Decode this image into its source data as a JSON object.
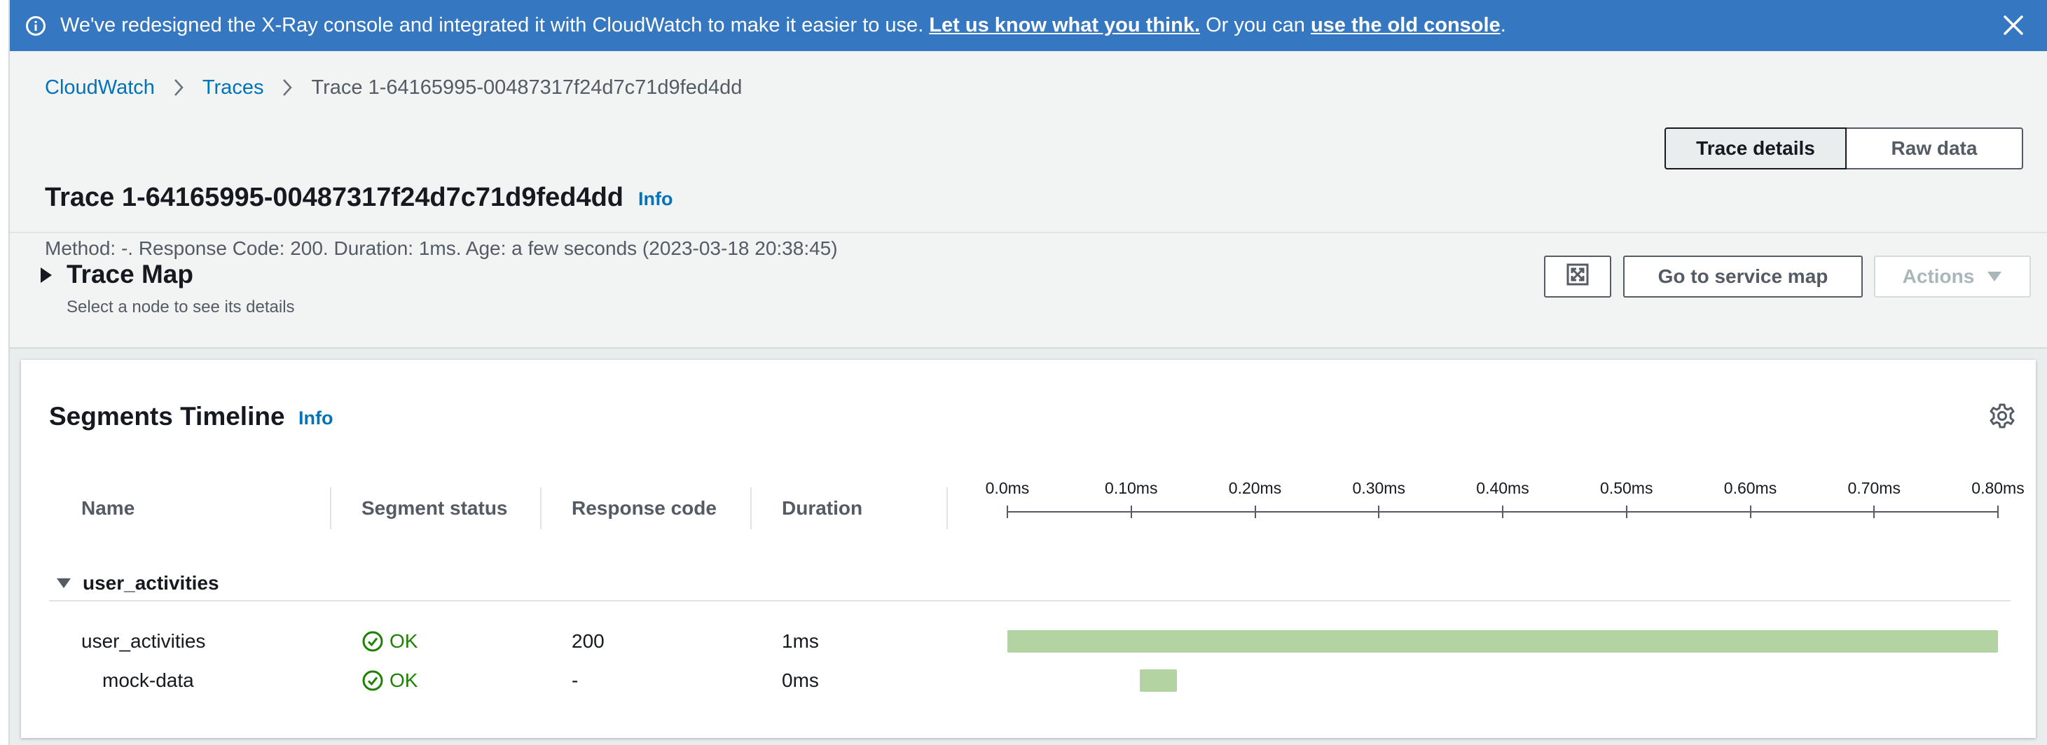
{
  "banner": {
    "text_before": "We've redesigned the X-Ray console and integrated it with CloudWatch to make it easier to use.",
    "feedback_link": "Let us know what you think.",
    "text_middle": "Or you can",
    "old_console_link": "use the old console",
    "text_after": "."
  },
  "breadcrumb": {
    "root": "CloudWatch",
    "traces": "Traces",
    "current": "Trace 1-64165995-00487317f24d7c71d9fed4dd"
  },
  "page": {
    "title": "Trace 1-64165995-00487317f24d7c71d9fed4dd",
    "info_label": "Info",
    "meta": "Method: -. Response Code: 200. Duration: 1ms. Age: a few seconds (2023-03-18 20:38:45)"
  },
  "view_toggle": {
    "details": "Trace details",
    "raw": "Raw data",
    "active": "Trace details"
  },
  "trace_map": {
    "title": "Trace Map",
    "subtitle": "Select a node to see its details",
    "goto_label": "Go to service map",
    "actions_label": "Actions"
  },
  "timeline": {
    "title": "Segments Timeline",
    "info_label": "Info",
    "columns": {
      "name": "Name",
      "status": "Segment status",
      "code": "Response code",
      "duration": "Duration"
    },
    "ticks": [
      "0.0ms",
      "0.10ms",
      "0.20ms",
      "0.30ms",
      "0.40ms",
      "0.50ms",
      "0.60ms",
      "0.70ms",
      "0.80ms"
    ],
    "group": "user_activities",
    "rows": [
      {
        "name": "user_activities",
        "status": "OK",
        "code": "200",
        "duration": "1ms",
        "start_ms": 0.0,
        "end_ms": 0.8
      },
      {
        "name": "mock-data",
        "status": "OK",
        "code": "-",
        "duration": "0ms",
        "start_ms": 0.107,
        "end_ms": 0.137
      }
    ]
  },
  "colors": {
    "banner": "#3577c1",
    "link": "#0073bb",
    "ok": "#1d8102",
    "bar": "#b3d3a2"
  }
}
